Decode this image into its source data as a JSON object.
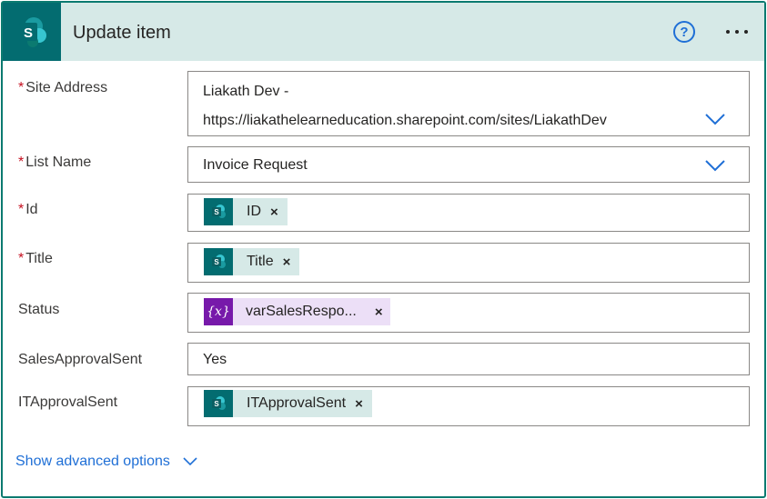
{
  "header": {
    "title": "Update item",
    "help_glyph": "?"
  },
  "fields": {
    "site_address": {
      "label": "Site Address",
      "required": "*",
      "value_line1": "Liakath Dev -",
      "value_line2": "https://liakathelearneducation.sharepoint.com/sites/LiakathDev"
    },
    "list_name": {
      "label": "List Name",
      "required": "*",
      "value": "Invoice Request"
    },
    "id": {
      "label": "Id",
      "required": "*",
      "token": "ID"
    },
    "title": {
      "label": "Title",
      "required": "*",
      "token": "Title"
    },
    "status": {
      "label": "Status",
      "token": "varSalesRespo...",
      "token_icon_text": "{x}"
    },
    "sales_approval_sent": {
      "label": "SalesApprovalSent",
      "value": "Yes"
    },
    "it_approval_sent": {
      "label": "ITApprovalSent",
      "token": "ITApprovalSent"
    }
  },
  "advanced": {
    "label": "Show advanced options"
  },
  "token_remove_glyph": "×",
  "icons": {
    "app": "sharepoint-icon",
    "help": "help-icon",
    "more": "more-options-icon",
    "dropdown": "chevron-down-icon",
    "variable": "variable-icon"
  },
  "colors": {
    "sharepoint_teal": "#036c70",
    "header_bg": "#d6e9e7",
    "variable_purple": "#7719aa",
    "link_blue": "#1f6fd6",
    "required_red": "#c50f1f"
  }
}
